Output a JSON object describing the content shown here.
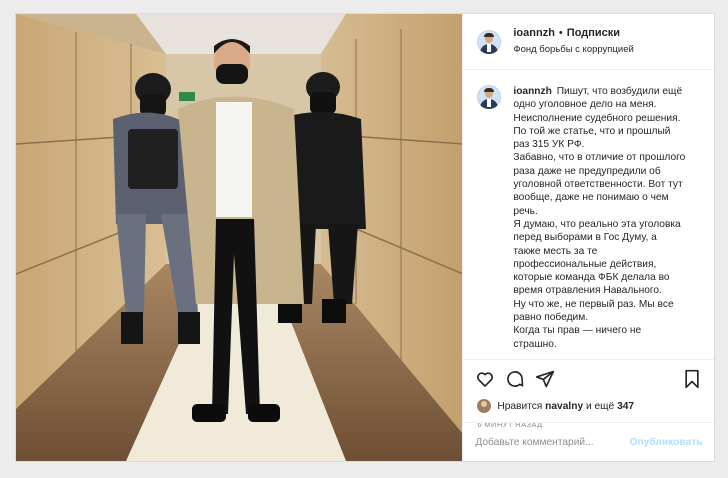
{
  "post": {
    "username": "ioannzh",
    "separator": "•",
    "follow_label": "Подписки",
    "location": "Фонд борьбы с коррупцией",
    "caption_username": "ioannzh",
    "caption_lines": [
      "Пишут, что возбудили ещё",
      "одно уголовное дело на меня.",
      "Неисполнение судебного решения.",
      "По той же статье, что и прошлый",
      "раз 315 УК РФ.",
      "Забавно, что в отличие от прошлого",
      "раза даже не предупредили об",
      "уголовной ответственности. Вот тут",
      "вообще, даже не понимаю о чем",
      "речь.",
      "Я думаю, что реально эта уголовка",
      "перед выборами в Гос Думу, а",
      "также месть за те",
      "профессиональные действия,",
      "которые команда ФБК делала во",
      "время отравления Навального.",
      "Ну что же, не первый раз. Мы все",
      "равно победим.",
      "Когда ты прав — ничего не",
      "страшно."
    ]
  },
  "likes": {
    "prefix": "Нравится",
    "user": "navalny",
    "middle": "и ещё",
    "count": "347"
  },
  "timestamp": "6 МИНУТ НАЗАД",
  "comment": {
    "placeholder": "Добавьте комментарий...",
    "publish_label": "Опубликовать"
  },
  "icons": {
    "like": "heart-icon",
    "comment": "comment-icon",
    "share": "share-icon",
    "save": "bookmark-icon"
  },
  "colors": {
    "link_disabled": "#b2dffc",
    "text": "#262626",
    "muted": "#8e8e8e"
  }
}
